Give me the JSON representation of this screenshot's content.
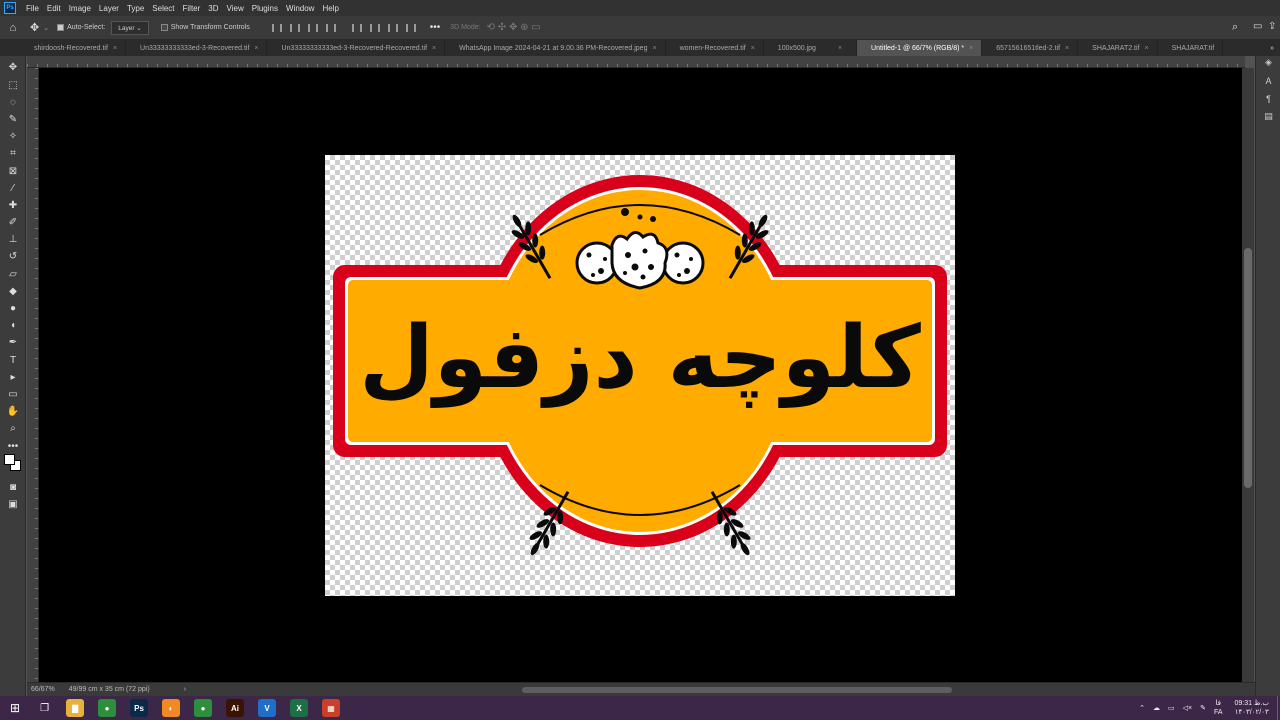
{
  "menubar": {
    "app_badge": "Ps",
    "items": [
      "File",
      "Edit",
      "Image",
      "Layer",
      "Type",
      "Select",
      "Filter",
      "3D",
      "View",
      "Plugins",
      "Window",
      "Help"
    ]
  },
  "options": {
    "auto_select_label": "Auto-Select:",
    "auto_select_value": "Layer",
    "transform_label": "Show Transform Controls",
    "mode_3d": "3D Mode:"
  },
  "tabs": [
    {
      "label": "shirdoosh-Recovered.tif",
      "active": false
    },
    {
      "label": "Un33333333333ed-3-Recovered.tif",
      "active": false
    },
    {
      "label": "Un33333333333ed-3-Recovered-Recovered.tif",
      "active": false
    },
    {
      "label": "WhatsApp Image 2024-04-21 at 9.00.36 PM-Recovered.jpeg",
      "active": false
    },
    {
      "label": "women-Recovered.tif",
      "active": false
    },
    {
      "label": "100x500.jpg",
      "active": false
    },
    {
      "label": "Untitled-1 @ 66/7% (RGB/8) *",
      "active": true
    },
    {
      "label": "6571561651tled-2.tif",
      "active": false
    },
    {
      "label": "SHAJARAT2.tif",
      "active": false
    },
    {
      "label": "SHAJARAT.tif",
      "active": false
    }
  ],
  "tab_close": "×",
  "tabs_overflow": "»",
  "canvas": {
    "logo_text": "کلوچه دزفول",
    "colors": {
      "red": "#d9001b",
      "orange": "#ffab00",
      "black": "#0a0a0a"
    }
  },
  "status": {
    "zoom": "66/67%",
    "doc_size": "49/99 cm x 35 cm (72 ppi)",
    "arrow": "›"
  },
  "taskbar": {
    "apps": [
      {
        "name": "file-explorer",
        "glyph": "▇",
        "color": "#e8b23a"
      },
      {
        "name": "chrome",
        "glyph": "●",
        "color": "#2d8f3b"
      },
      {
        "name": "photoshop",
        "glyph": "Ps",
        "color": "#0b2a4a"
      },
      {
        "name": "app-orange",
        "glyph": "◐",
        "color": "#f08a24"
      },
      {
        "name": "chrome-2",
        "glyph": "●",
        "color": "#2d8f3b"
      },
      {
        "name": "illustrator",
        "glyph": "Ai",
        "color": "#3a1400"
      },
      {
        "name": "app-v",
        "glyph": "V",
        "color": "#1f6fc9"
      },
      {
        "name": "excel",
        "glyph": "X",
        "color": "#1d7044"
      },
      {
        "name": "app-grid",
        "glyph": "▦",
        "color": "#c8402a"
      }
    ],
    "lang": "فا",
    "lang_code": "FA",
    "time": "09:31 ب.ظ",
    "date": "۱۴۰۳/۰۲/۰۳"
  }
}
